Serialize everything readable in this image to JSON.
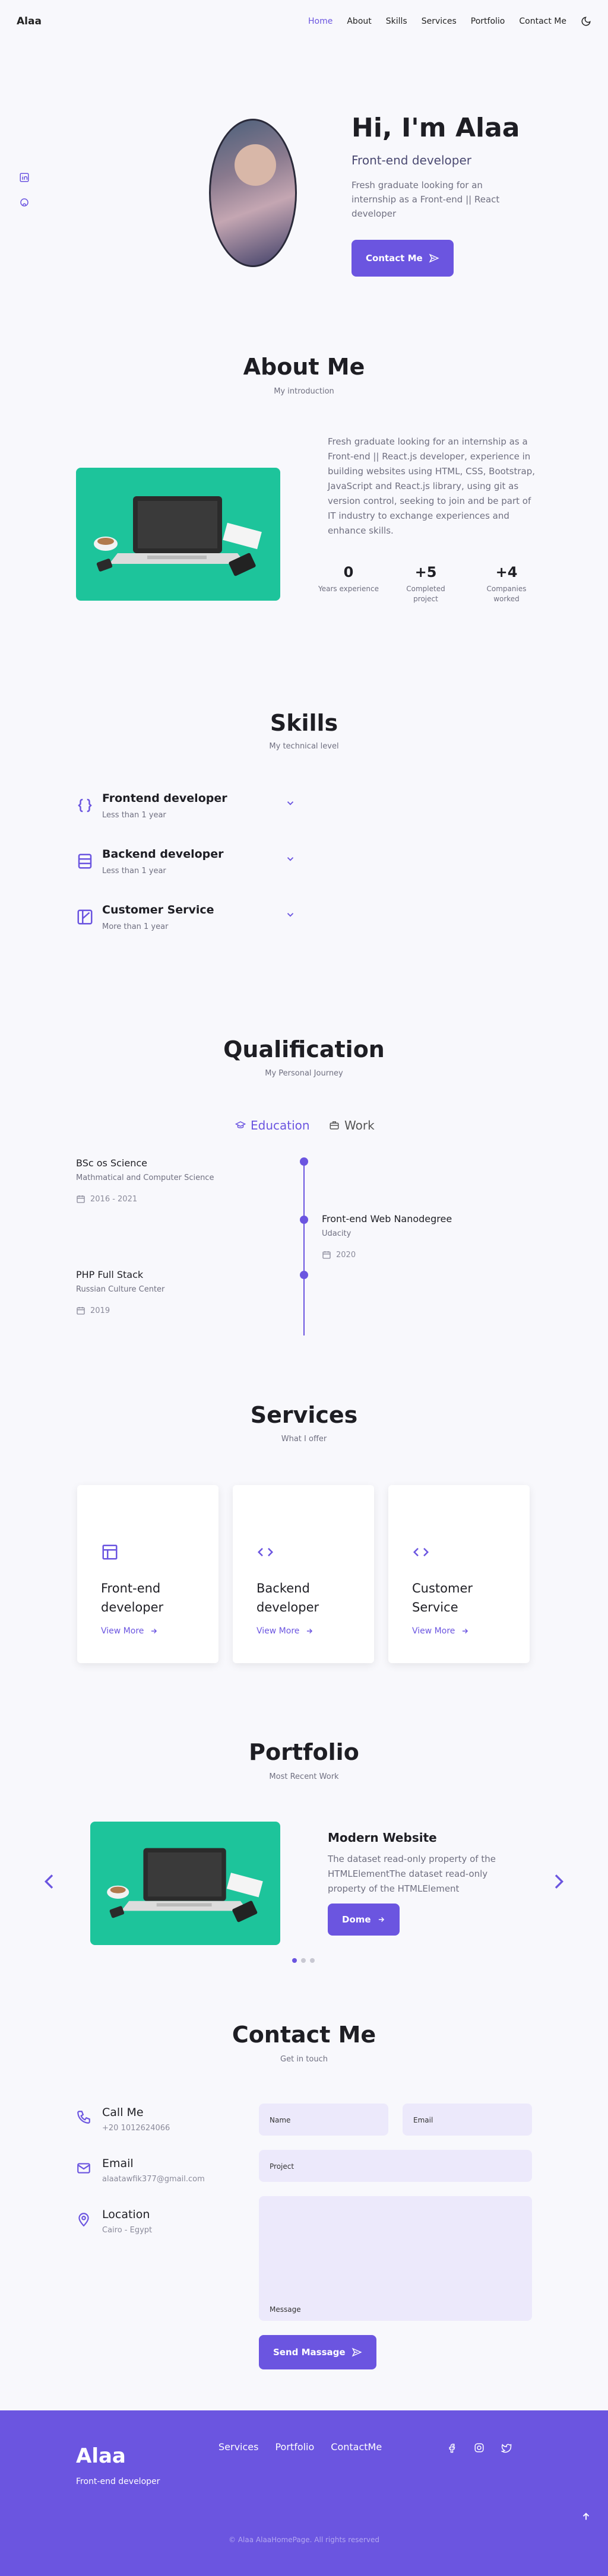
{
  "header": {
    "logo": "Alaa",
    "nav": [
      "Home",
      "About",
      "Skills",
      "Services",
      "Portfolio",
      "Contact Me"
    ],
    "active_nav": "Home"
  },
  "hero": {
    "title": "Hi, I'm Alaa",
    "subtitle": "Front-end developer",
    "description": "Fresh graduate looking for an internship as a Front-end || React developer",
    "button": "Contact Me"
  },
  "about": {
    "title": "About Me",
    "subtitle": "My introduction",
    "description": "Fresh graduate looking for an internship as a Front-end || React.js developer, experience in building websites using HTML, CSS, Bootstrap, JavaScript and React.js library, using git as version control, seeking to join and be part of IT industry to exchange experiences and enhance skills.",
    "stats": [
      {
        "num": "0",
        "label": "Years experience"
      },
      {
        "num": "+5",
        "label": "Completed project"
      },
      {
        "num": "+4",
        "label": "Companies worked"
      }
    ]
  },
  "skills": {
    "title": "Skills",
    "subtitle": "My technical level",
    "items": [
      {
        "name": "Frontend developer",
        "exp": "Less than 1 year"
      },
      {
        "name": "Backend developer",
        "exp": "Less than 1 year"
      },
      {
        "name": "Customer Service",
        "exp": "More than 1 year"
      }
    ]
  },
  "qualification": {
    "title": "Qualification",
    "subtitle": "My Personal Journey",
    "tabs": [
      "Education",
      "Work"
    ],
    "items": [
      {
        "title": "BSc os Science",
        "place": "Mathmatical and Computer Science",
        "date": "2016 - 2021"
      },
      {
        "title": "Front-end Web Nanodegree",
        "place": "Udacity",
        "date": "2020"
      },
      {
        "title": "PHP Full Stack",
        "place": "Russian Culture Center",
        "date": "2019"
      }
    ]
  },
  "services": {
    "title": "Services",
    "subtitle": "What I offer",
    "items": [
      "Front-end developer",
      "Backend developer",
      "Customer Service"
    ],
    "more_label": "View More"
  },
  "portfolio": {
    "title": "Portfolio",
    "subtitle": "Most Recent Work",
    "project_title": "Modern Website",
    "project_desc": "The dataset read-only property of the HTMLElementThe dataset read-only property of the HTMLElement",
    "button": "Dome",
    "active_slide": 1,
    "slide_count": 3
  },
  "contact": {
    "title": "Contact Me",
    "subtitle": "Get in touch",
    "info": [
      {
        "title": "Call Me",
        "value": "+20 1012624066"
      },
      {
        "title": "Email",
        "value": "alaatawfik377@gmail.com"
      },
      {
        "title": "Location",
        "value": "Cairo - Egypt"
      }
    ],
    "fields": {
      "name": "Name",
      "email": "Email",
      "project": "Project",
      "message": "Message"
    },
    "button": "Send Massage"
  },
  "footer": {
    "logo": "Alaa",
    "role": "Front-end developer",
    "links": [
      "Services",
      "Portfolio",
      "ContactMe"
    ],
    "copyright": "© Alaa AlaaHomePage. All rights reserved"
  },
  "colors": {
    "accent": "#6b55e0",
    "background": "#f8f8fc",
    "card_green": "#1dc49b"
  }
}
